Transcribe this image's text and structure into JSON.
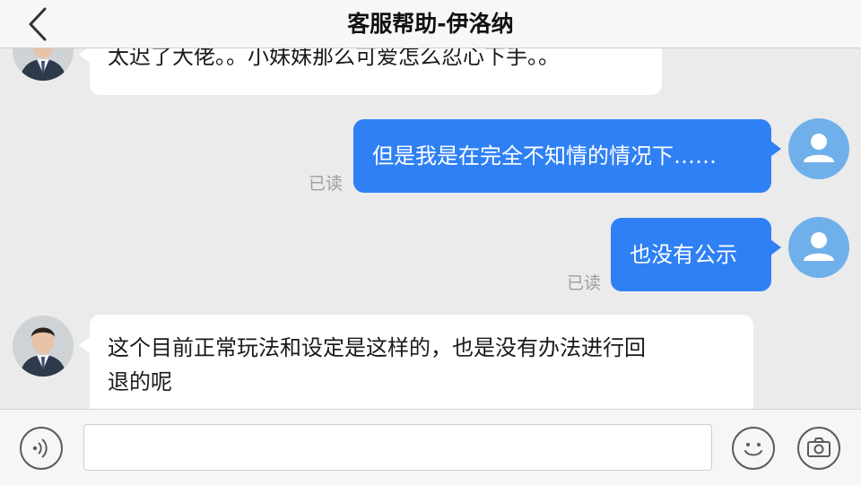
{
  "header": {
    "title": "客服帮助-伊洛纳",
    "back_icon": "chevron-left-icon"
  },
  "messages": [
    {
      "sender": "agent",
      "text": "太迟了大佬。。小妹妹那么可爱怎么忍心下手。。"
    },
    {
      "sender": "user",
      "text": "但是我是在完全不知情的情况下……",
      "status": "已读"
    },
    {
      "sender": "user",
      "text": "也没有公示",
      "status": "已读"
    },
    {
      "sender": "agent",
      "text_lines": [
        "这个目前正常玩法和设定是这样的，也是没有办法进行回",
        "退的呢"
      ]
    }
  ],
  "inputbar": {
    "voice_icon": "voice-icon",
    "input_value": "",
    "emoji_icon": "emoji-icon",
    "camera_icon": "camera-icon"
  },
  "colors": {
    "background": "#ebebeb",
    "user_bubble": "#2f80f5",
    "agent_bubble": "#ffffff",
    "user_avatar": "#6fb0ea",
    "read_text": "#9e9e9e"
  }
}
